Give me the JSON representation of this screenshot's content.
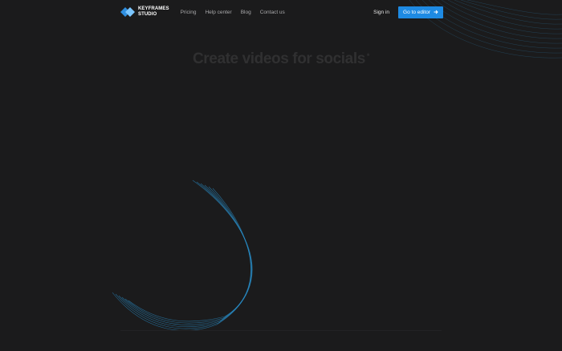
{
  "nav": {
    "logo_line1": "KEYFRAMES",
    "logo_line2": "STUDIO",
    "links": [
      "Pricing",
      "Help center",
      "Blog",
      "Contact us"
    ],
    "sign_in": "Sign in",
    "cta_label": "Go to editor",
    "cta_icon": "arrow-right-icon"
  },
  "hero": {
    "title": "Create videos for socials",
    "title_mark": "*"
  },
  "colors": {
    "background": "#1b1b1c",
    "accent": "#1e8ae3",
    "logo_light": "#7cc6ff",
    "logo_dark": "#2f8fe0",
    "deco_line": "#2a8fc9"
  }
}
